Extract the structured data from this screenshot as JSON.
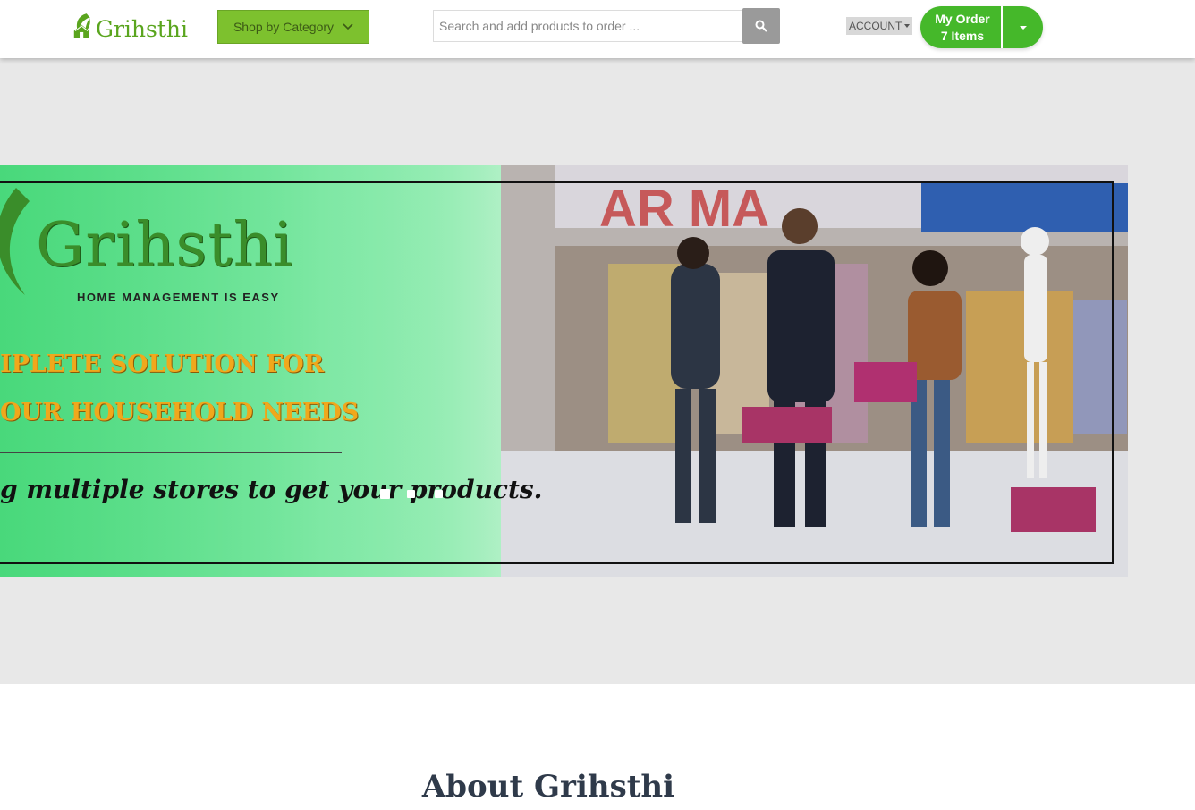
{
  "header": {
    "brand": "Grihsthi",
    "shop_by_category": "Shop by Category",
    "search_placeholder": "Search and add products to order ...",
    "account_label": "ACCOUNT",
    "order_label": "My Order",
    "order_count": "7 Items"
  },
  "banner": {
    "brand": "Grihsthi",
    "tagline": "HOME MANAGEMENT IS EASY",
    "line1": "IPLETE SOLUTION FOR",
    "line2": "OUR HOUSEHOLD NEEDS",
    "line3": "g multiple stores to get your products."
  },
  "about": {
    "title": "About Grihsthi"
  },
  "colors": {
    "brand_green": "#7dc12e",
    "order_green": "#45b82a",
    "search_button": "#9a9a9a"
  }
}
